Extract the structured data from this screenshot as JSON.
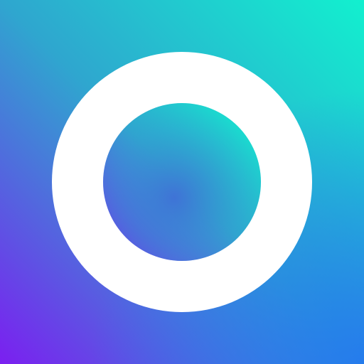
{
  "icon": {
    "name": "ring-icon",
    "shape": "ring",
    "colors": {
      "ring": "#FFFFFF",
      "gradient_top_right": "#12F0CF",
      "gradient_mid": "#2FA6CF",
      "gradient_bottom_left": "#7B1FF0",
      "gradient_bottom_right": "#2374F2",
      "inner_center": "#3F73D6"
    }
  }
}
